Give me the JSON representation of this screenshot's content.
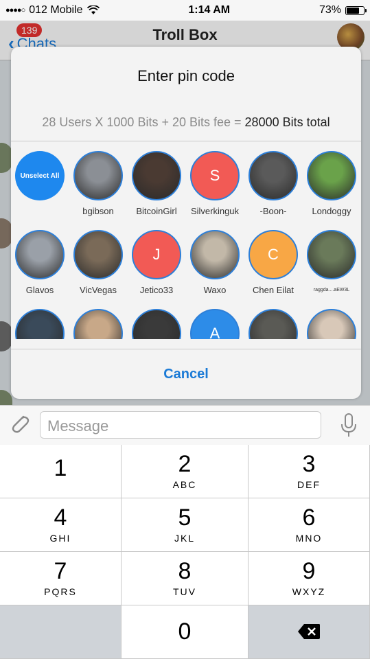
{
  "status": {
    "carrier": "012 Mobile",
    "time": "1:14 AM",
    "battery": "73%",
    "battery_level": 0.73
  },
  "nav": {
    "back_label": "Chats",
    "badge": "139",
    "title": "Troll Box"
  },
  "dialog": {
    "title": "Enter pin code",
    "summary_equation": "28 Users X 1000 Bits + 20 Bits fee =",
    "summary_total": "28000 Bits total",
    "cancel_label": "Cancel",
    "users": [
      {
        "name": "",
        "label": "Unselect All",
        "kind": "button",
        "color": "#1e88ee"
      },
      {
        "name": "bgibson",
        "kind": "photo",
        "color": "#8b8f95"
      },
      {
        "name": "BitcoinGirl",
        "kind": "photo",
        "color": "#4a3a32"
      },
      {
        "name": "Silverkinguk",
        "kind": "initial",
        "initial": "S",
        "color": "#f25a55"
      },
      {
        "name": "-Boon-",
        "kind": "photo",
        "color": "#5a5a5a"
      },
      {
        "name": "Londoggy",
        "kind": "photo",
        "color": "#6aa24a"
      },
      {
        "name": "Glavos",
        "kind": "photo",
        "color": "#9aa0a8"
      },
      {
        "name": "VicVegas",
        "kind": "photo",
        "color": "#7a6a58"
      },
      {
        "name": "Jetico33",
        "kind": "initial",
        "initial": "J",
        "color": "#f25a55"
      },
      {
        "name": "Waxo",
        "kind": "photo",
        "color": "#c2b8a8"
      },
      {
        "name": "Chen Eilat",
        "kind": "initial",
        "initial": "C",
        "color": "#f8a745"
      },
      {
        "name": "raggda....aEW3L",
        "kind": "photo",
        "color": "#6a7a5a"
      },
      {
        "name": "",
        "kind": "photo",
        "color": "#3a4a5a"
      },
      {
        "name": "",
        "kind": "photo",
        "color": "#c8a888"
      },
      {
        "name": "",
        "kind": "photo",
        "color": "#3a3a3a"
      },
      {
        "name": "",
        "kind": "initial",
        "initial": "A",
        "color": "#2d8ce8"
      },
      {
        "name": "",
        "kind": "photo",
        "color": "#5a5a55"
      },
      {
        "name": "",
        "kind": "photo",
        "color": "#d8c8b8"
      }
    ]
  },
  "input": {
    "placeholder": "Message"
  },
  "keypad": {
    "keys": [
      {
        "num": "1",
        "letters": ""
      },
      {
        "num": "2",
        "letters": "ABC"
      },
      {
        "num": "3",
        "letters": "DEF"
      },
      {
        "num": "4",
        "letters": "GHI"
      },
      {
        "num": "5",
        "letters": "JKL"
      },
      {
        "num": "6",
        "letters": "MNO"
      },
      {
        "num": "7",
        "letters": "PQRS"
      },
      {
        "num": "8",
        "letters": "TUV"
      },
      {
        "num": "9",
        "letters": "WXYZ"
      },
      {
        "num": "0",
        "letters": ""
      }
    ]
  }
}
